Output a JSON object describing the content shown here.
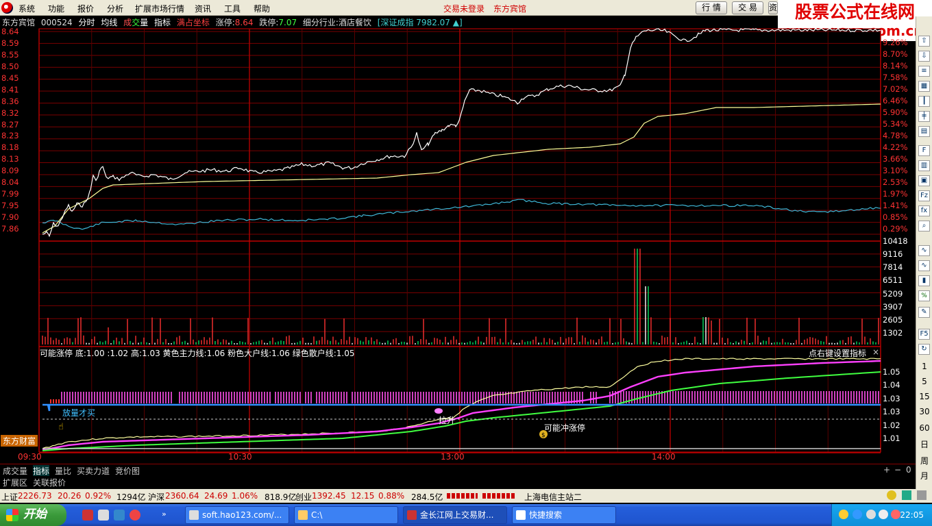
{
  "menu": {
    "items": [
      "系统",
      "功能",
      "报价",
      "分析",
      "扩展市场行情",
      "资讯",
      "工具",
      "帮助"
    ],
    "login_status": "交易未登录",
    "stock_name": "东方宾馆",
    "btn_market": "行 情",
    "btn_trade": "交 易",
    "btn_partial": "资"
  },
  "watermark": {
    "line1": "股票公式在线网",
    "line2": "www.gsxz.com.cn"
  },
  "info": {
    "stock": "东方宾馆",
    "code": "000524",
    "tab_intraday": "分时",
    "tab_avg": "均线",
    "tab_vol_a": "成",
    "tab_vol_b": "交",
    "tab_vol_c": "量",
    "tab_indicator": "指标",
    "tab_coord": "满占坐标",
    "limit_up_label": "涨停:",
    "limit_up": "8.64",
    "limit_down_label": "跌停:",
    "limit_down": "7.07",
    "industry": "细分行业:酒店餐饮",
    "index": "[深证成指 7982.07 ▲]"
  },
  "price_axis": [
    "8.64",
    "8.59",
    "8.55",
    "8.50",
    "8.45",
    "8.41",
    "8.36",
    "8.32",
    "8.27",
    "8.23",
    "8.18",
    "8.13",
    "8.09",
    "8.04",
    "7.99",
    "7.95",
    "7.90",
    "7.86"
  ],
  "pct_axis": [
    "9.26%",
    "8.70%",
    "8.14%",
    "7.58%",
    "7.02%",
    "6.46%",
    "5.90%",
    "5.34%",
    "4.78%",
    "4.22%",
    "3.66%",
    "3.10%",
    "2.53%",
    "1.97%",
    "1.41%",
    "0.85%",
    "0.29%"
  ],
  "vol_axis": [
    "10418",
    "9116",
    "7814",
    "6511",
    "5209",
    "3907",
    "2605",
    "1302"
  ],
  "indicator": {
    "title": "可能涨停 底:1.00 :1.02 高:1.03 黄色主力线:1.06 粉色大户线:1.06 绿色散户线:1.05",
    "hint": "点右键设置指标",
    "close": "×",
    "axis": [
      "1.05",
      "1.04",
      "1.03",
      "1.03",
      "1.02",
      "1.01"
    ],
    "label_volume_buy": "放量才买",
    "label_pull_up": "拉升",
    "label_limit_up": "可能冲涨停"
  },
  "time_axis": [
    "09:30",
    "10:30",
    "13:00",
    "14:00"
  ],
  "brand_tag": "东方财富",
  "bottom_tabs": [
    "成交量",
    "指标",
    "量比",
    "买卖力道",
    "竞价图"
  ],
  "bottom_tab_active": "指标",
  "bottom_controls": [
    "+",
    "−",
    "0"
  ],
  "ext_tabs": [
    "扩展区",
    "关联报价"
  ],
  "toolbar_numbers": [
    "1",
    "5",
    "15",
    "30",
    "60",
    "日",
    "周",
    "月"
  ],
  "status": {
    "sh_label": "上证",
    "sh_value": "2226.73",
    "sh_change": "20.26",
    "sh_pct": "0.92%",
    "sh_amount": "1294亿",
    "hs_label": "沪深",
    "hs_value": "2360.64",
    "hs_change": "24.69",
    "hs_pct": "1.06%",
    "hs_amount": "818.9亿",
    "cy_label": "创业",
    "cy_value": "1392.45",
    "cy_change": "12.15",
    "cy_pct": "0.88%",
    "cy_amount": "284.5亿",
    "server": "上海电信主站二"
  },
  "taskbar": {
    "start": "开始",
    "tasks": [
      "soft.hao123.com/...",
      "C:\\",
      "金长江网上交易财...",
      "快捷搜索"
    ],
    "clock": "22:05"
  },
  "colors": {
    "price_line": "#ffffff",
    "avg_line": "#ffff99",
    "index_line": "#3fb8d8",
    "grid": "#8b0000",
    "vol_up": "#ff3030",
    "vol_down": "#00e060",
    "main_line": "#ffffa0",
    "big_line": "#ff40ff",
    "retail_line": "#40ff40"
  }
}
